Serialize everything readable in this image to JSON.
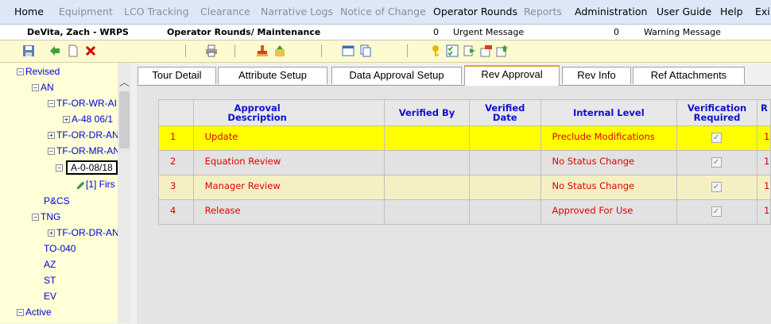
{
  "menu": [
    {
      "label": "Home",
      "enabled": true
    },
    {
      "label": "Equipment",
      "enabled": false
    },
    {
      "label": "LCO Tracking",
      "enabled": false
    },
    {
      "label": "Clearance",
      "enabled": false
    },
    {
      "label": "Narrative Logs",
      "enabled": false
    },
    {
      "label": "Notice of Change",
      "enabled": false
    },
    {
      "label": "Operator Rounds",
      "enabled": true
    },
    {
      "label": "Reports",
      "enabled": false
    },
    {
      "label": "Administration",
      "enabled": true
    },
    {
      "label": "User Guide",
      "enabled": true
    },
    {
      "label": "Help",
      "enabled": true
    },
    {
      "label": "Exi",
      "enabled": true
    }
  ],
  "userbar": {
    "user": "DeVita, Zach - WRPS",
    "module": "Operator Rounds/ Maintenance",
    "urgent_count": "0",
    "urgent_label": "Urgent Message",
    "warning_count": "0",
    "warning_label": "Warning Message"
  },
  "toolbar_icons": [
    "save-icon",
    "back-arrow-icon",
    "new-document-icon",
    "delete-x-icon",
    "print-icon",
    "stamp-icon",
    "approve-icon",
    "window-icon",
    "copy-icon",
    "key-icon",
    "checklist-icon",
    "forward-icon",
    "export-icon",
    "import-icon"
  ],
  "tree": {
    "revised": "Revised",
    "an": "AN",
    "tf_or_wr": "TF-OR-WR-AI",
    "a48": "A-48 06/1",
    "tf_or_dr": "TF-OR-DR-AN",
    "tf_or_mr": "TF-OR-MR-AN",
    "a0": "A-0-08/18",
    "first": "[1] Firs",
    "pcs": "P&CS",
    "tng": "TNG",
    "tng_tf": "TF-OR-DR-AN",
    "to040": "TO-040",
    "az": "AZ",
    "st": "ST",
    "ev": "EV",
    "active": "Active"
  },
  "tabs": [
    "Tour Detail",
    "Attribute Setup",
    "Data Approval Setup",
    "Rev Approval",
    "Rev Info",
    "Ref Attachments"
  ],
  "selected_tab": "Rev Approval",
  "grid": {
    "headers": {
      "approval_description": "Approval Description",
      "verified_by": "Verified By",
      "verified_date": "Verified Date",
      "internal_level": "Internal Level",
      "verification_required": "Verification Required",
      "partial": "R"
    },
    "rows": [
      {
        "num": "1",
        "description": "Update",
        "verified_by": "",
        "verified_date": "",
        "internal_level": "Preclude Modifications",
        "required": true,
        "extra": "1"
      },
      {
        "num": "2",
        "description": "Equation Review",
        "verified_by": "",
        "verified_date": "",
        "internal_level": "No Status Change",
        "required": true,
        "extra": "1"
      },
      {
        "num": "3",
        "description": "Manager Review",
        "verified_by": "",
        "verified_date": "",
        "internal_level": "No Status Change",
        "required": true,
        "extra": "1"
      },
      {
        "num": "4",
        "description": "Release",
        "verified_by": "",
        "verified_date": "",
        "internal_level": "Approved For Use",
        "required": true,
        "extra": "1"
      }
    ]
  }
}
